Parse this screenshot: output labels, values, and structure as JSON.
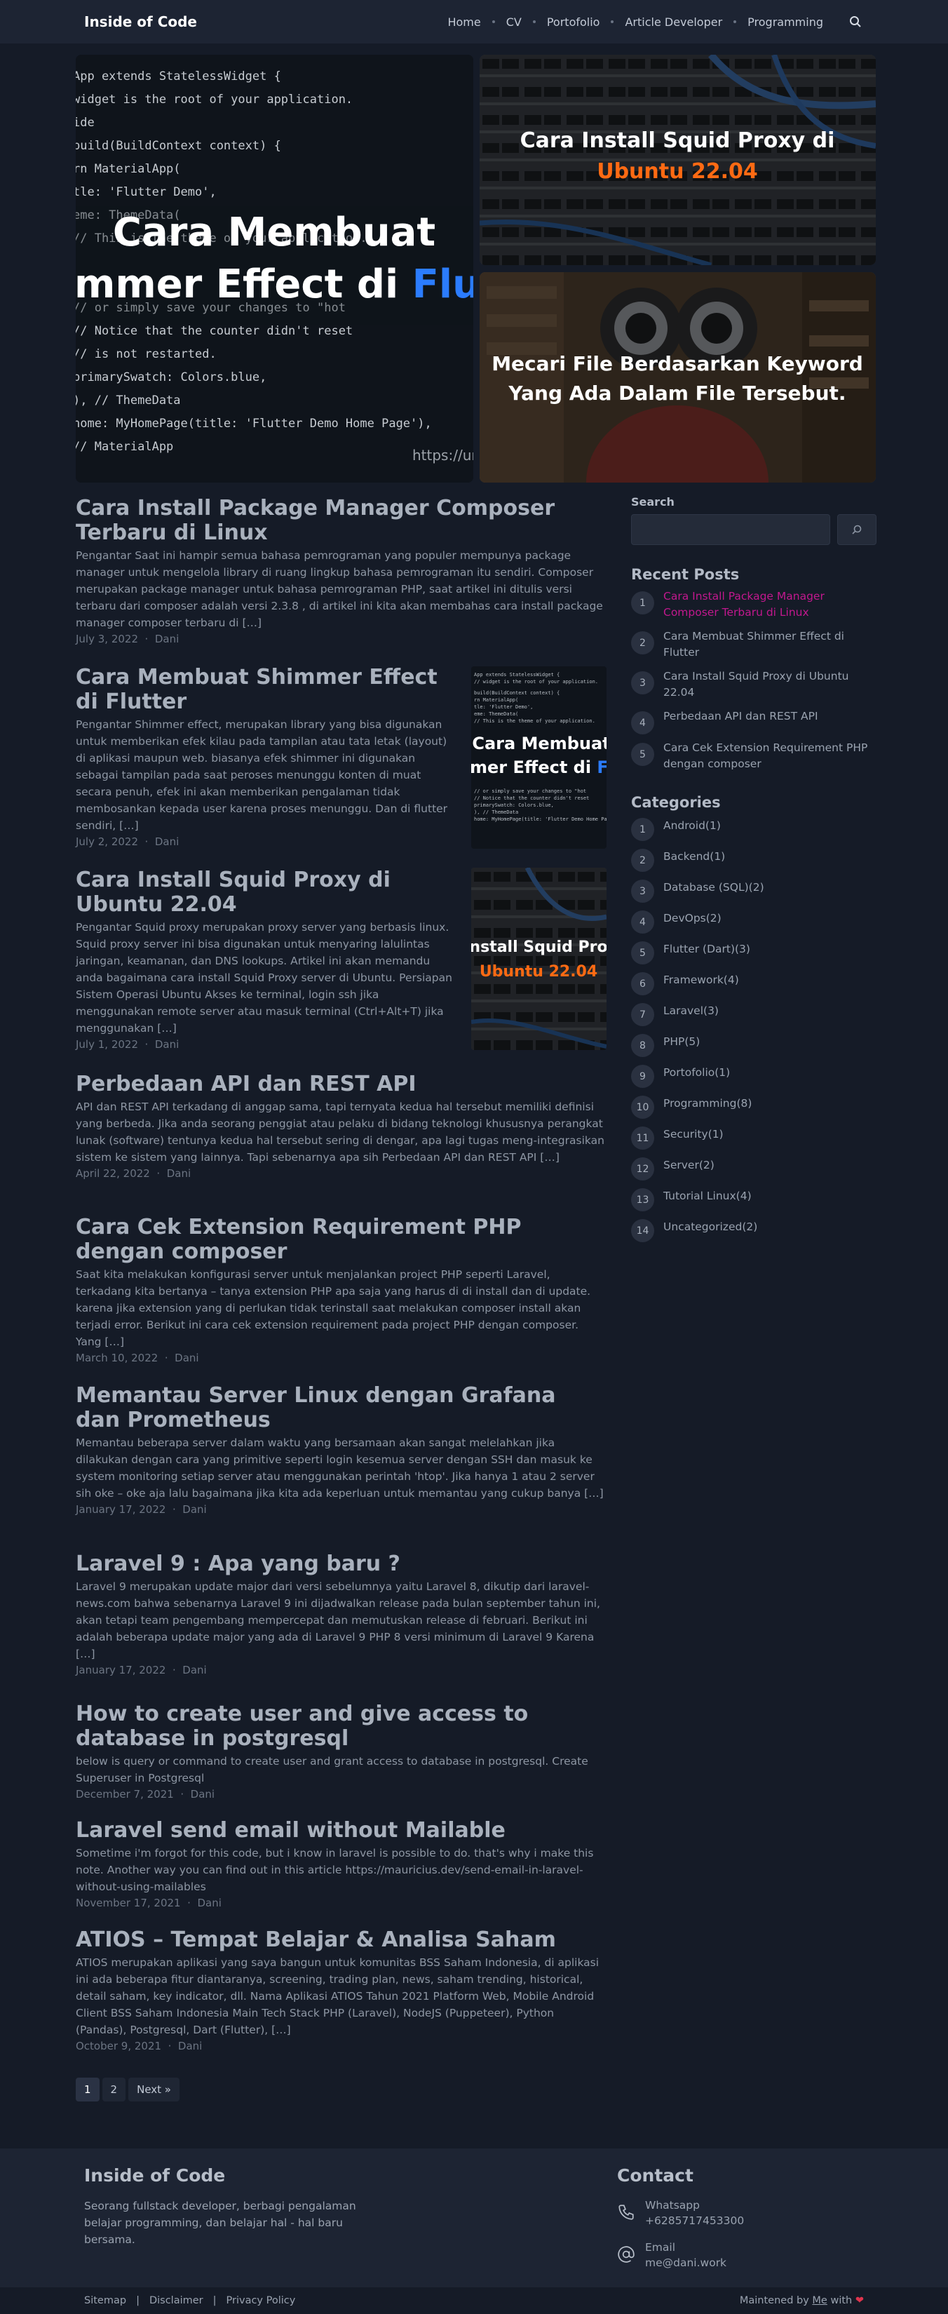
{
  "header": {
    "brand": "Inside of Code",
    "nav": [
      "Home",
      "CV",
      "Portofolio",
      "Article Developer",
      "Programming"
    ]
  },
  "hero": {
    "big": {
      "line1": "Cara Membuat",
      "line2a": "mmer Effect di ",
      "line2b": "Flut",
      "url": "https://ur",
      "code": [
        "App extends StatelessWidget {",
        "  widget is the root of your application.",
        "ide",
        "  build(BuildContext context) {",
        "  rn MaterialApp(",
        "  tle: 'Flutter Demo',",
        "  eme: ThemeData(",
        "  // This is the theme of your application.",
        "",
        "",
        "  // or simply save your changes to \"hot",
        "  // Notice that the counter didn't reset",
        "  // is not restarted.",
        "  primarySwatch: Colors.blue,",
        "  ), // ThemeData",
        "  home: MyHomePage(title: 'Flutter Demo Home Page'),",
        "  // MaterialApp"
      ]
    },
    "small1": {
      "line1": "Cara Install Squid Proxy di",
      "line2": "Ubuntu 22.04"
    },
    "small2": {
      "line1": "Mecari File Berdasarkan Keyword",
      "line2": "Yang Ada Dalam File Tersebut."
    }
  },
  "posts": [
    {
      "title": "Cara Install Package Manager Composer Terbaru di Linux",
      "excerpt": "Pengantar Saat ini hampir semua bahasa pemrograman yang populer mempunya package manager untuk mengelola library di ruang lingkup bahasa pemrograman itu sendiri. Composer merupakan package manager untuk bahasa pemrograman PHP, saat artikel ini ditulis versi terbaru dari composer adalah versi 2.3.8 , di artikel ini kita akan membahas cara install package manager composer terbaru di […]",
      "date": "July 3, 2022",
      "author": "Dani"
    },
    {
      "title": "Cara Membuat Shimmer Effect di Flutter",
      "excerpt": "Pengantar Shimmer effect, merupakan library yang bisa digunakan untuk memberikan efek kilau pada tampilan atau tata letak (layout) di aplikasi maupun web. biasanya efek shimmer ini digunakan sebagai tampilan pada saat peroses menunggu konten di muat secara penuh, efek ini akan memberikan pengalaman tidak membosankan kepada user karena proses menunggu. Dan di flutter sendiri, […]",
      "date": "July 2, 2022",
      "author": "Dani"
    },
    {
      "title": "Cara Install Squid Proxy di Ubuntu 22.04",
      "excerpt": "Pengantar Squid proxy merupakan proxy server yang berbasis linux. Squid proxy server ini bisa digunakan untuk menyaring lalulintas jaringan, keamanan, dan DNS lookups. Artikel ini akan memandu anda bagaimana cara install Squid Proxy server di Ubuntu. Persiapan Sistem Operasi Ubuntu Akses ke terminal, login ssh jika menggunakan remote server atau masuk terminal (Ctrl+Alt+T) jika menggunakan […]",
      "date": "July 1, 2022",
      "author": "Dani"
    },
    {
      "title": "Perbedaan API dan REST API",
      "excerpt": "API dan REST API terkadang di anggap sama, tapi ternyata kedua hal tersebut memiliki definisi yang berbeda. Jika anda seorang penggiat atau pelaku di bidang teknologi khususnya perangkat lunak (software) tentunya kedua hal tersebut sering di dengar, apa lagi tugas meng-integrasikan sistem ke sistem yang lainnya. Tapi sebenarnya apa sih Perbedaan API dan REST API […]",
      "date": "April 22, 2022",
      "author": "Dani"
    },
    {
      "title": "Cara Cek Extension Requirement PHP dengan composer",
      "excerpt": "Saat kita melakukan konfigurasi server untuk menjalankan project PHP seperti Laravel, terkadang kita bertanya – tanya extension PHP apa saja yang harus di di install dan di update. karena jika extension yang di perlukan tidak terinstall saat melakukan composer install akan terjadi error. Berikut ini cara cek extension requirement pada project PHP dengan composer. Yang […]",
      "date": "March 10, 2022",
      "author": "Dani"
    },
    {
      "title": "Memantau Server Linux dengan Grafana dan Prometheus",
      "excerpt": "Memantau beberapa server dalam waktu yang bersamaan akan sangat melelahkan jika dilakukan dengan cara yang primitive seperti login kesemua server dengan SSH dan masuk ke system monitoring setiap server atau menggunakan perintah 'htop'. Jika hanya 1 atau 2 server sih oke – oke aja lalu bagaimana jika kita ada keperluan untuk memantau yang cukup banya […]",
      "date": "January 17, 2022",
      "author": "Dani"
    },
    {
      "title": "Laravel 9 : Apa yang baru ?",
      "excerpt": "Laravel 9 merupakan update major dari versi sebelumnya yaitu Laravel 8, dikutip dari laravel-news.com bahwa sebenarnya Laravel 9 ini dijadwalkan release pada bulan september tahun ini, akan tetapi team pengembang mempercepat dan memutuskan release di februari. Berikut ini adalah beberapa update major yang ada di Laravel 9 PHP 8 versi minimum di Laravel 9 Karena […]",
      "date": "January 17, 2022",
      "author": "Dani"
    },
    {
      "title": "How to create user and give access to database in postgresql",
      "excerpt": "below is query or command to create user and grant access to database in postgresql. Create Superuser in Postgresql",
      "date": "December 7, 2021",
      "author": "Dani"
    },
    {
      "title": "Laravel send email without Mailable",
      "excerpt": "Sometime i'm forgot for this code, but i know in laravel is possible to do. that's why i make this note. Another way you can find out in this article https://mauricius.dev/send-email-in-laravel-without-using-mailables",
      "date": "November 17, 2021",
      "author": "Dani"
    },
    {
      "title": "ATIOS – Tempat Belajar & Analisa Saham",
      "excerpt": "ATIOS merupakan aplikasi yang saya bangun untuk komunitas BSS Saham Indonesia, di aplikasi ini ada beberapa fitur diantaranya, screening, trading plan, news, saham trending, historical, detail saham, key indicator, dll. Nama Aplikasi ATIOS Tahun 2021 Platform Web, Mobile Android Client BSS Saham Indonesia Main Tech Stack PHP (Laravel), NodeJS (Puppeteer), Python (Pandas), Postgresql, Dart (Flutter), […]",
      "date": "October 9, 2021",
      "author": "Dani"
    }
  ],
  "thumbs": {
    "shimmer": {
      "line1": "Cara Membuat",
      "line2a": "mer Effect di ",
      "line2b": "Fl"
    },
    "squid": {
      "line1": "nstall Squid Pro",
      "line2": "Ubuntu 22.04"
    }
  },
  "sidebar": {
    "search_label": "Search",
    "search_placeholder": "",
    "recent_title": "Recent Posts",
    "recent": [
      "Cara Install Package Manager Composer Terbaru di Linux",
      "Cara Membuat Shimmer Effect di Flutter",
      "Cara Install Squid Proxy di Ubuntu 22.04",
      "Perbedaan API dan REST API",
      "Cara Cek Extension Requirement PHP dengan composer"
    ],
    "categories_title": "Categories",
    "categories": [
      {
        "name": "Android",
        "count": "(1)"
      },
      {
        "name": "Backend",
        "count": "(1)"
      },
      {
        "name": "Database (SQL)",
        "count": "(2)"
      },
      {
        "name": "DevOps",
        "count": "(2)"
      },
      {
        "name": "Flutter (Dart)",
        "count": "(3)"
      },
      {
        "name": "Framework",
        "count": "(4)"
      },
      {
        "name": "Laravel",
        "count": "(3)"
      },
      {
        "name": "PHP",
        "count": "(5)"
      },
      {
        "name": "Portofolio",
        "count": "(1)"
      },
      {
        "name": "Programming",
        "count": "(8)"
      },
      {
        "name": "Security",
        "count": "(1)"
      },
      {
        "name": "Server",
        "count": "(2)"
      },
      {
        "name": "Tutorial Linux",
        "count": "(4)"
      },
      {
        "name": "Uncategorized",
        "count": "(2)"
      }
    ]
  },
  "pagination": {
    "pages": [
      "1",
      "2"
    ],
    "next": "Next »"
  },
  "footer": {
    "brand": "Inside of Code",
    "desc": "Seorang fullstack developer, berbagi pengalaman belajar programming, dan belajar hal - hal baru bersama.",
    "contact_title": "Contact",
    "whatsapp_label": "Whatsapp",
    "whatsapp_value": "+6285717453300",
    "email_label": "Email",
    "email_value": "me@dani.work",
    "links": [
      "Sitemap",
      "Disclaimer",
      "Privacy Policy"
    ],
    "maintained_prefix": "Maintened by ",
    "maintained_me": "Me",
    "maintained_suffix": " with "
  },
  "colors": {
    "accent": "#c2188e",
    "orange": "#ff6a13",
    "blue": "#2b7cff",
    "heart": "#e0344d"
  }
}
